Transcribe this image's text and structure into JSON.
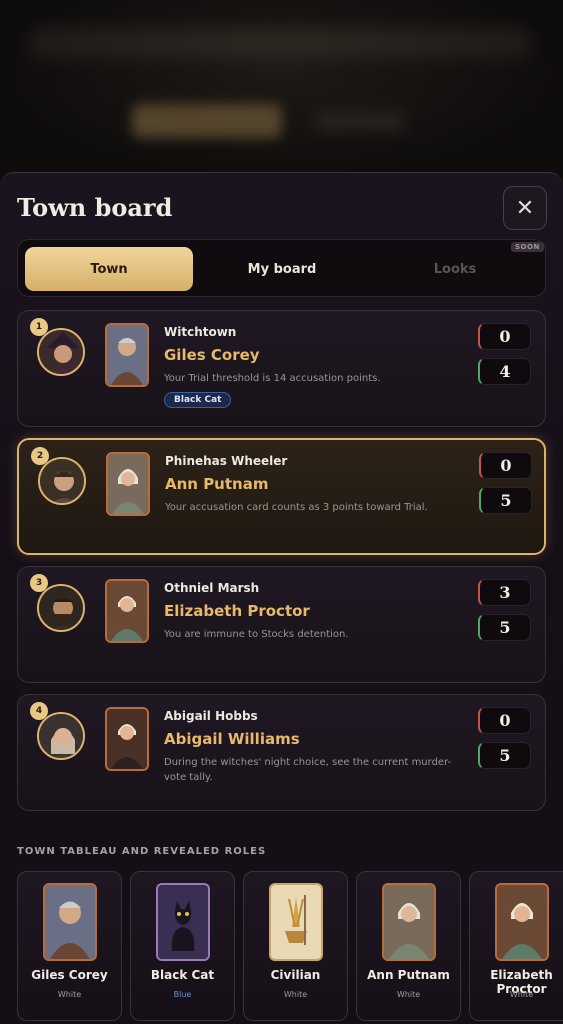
{
  "sheet": {
    "title": "Town board",
    "close_icon": "✕"
  },
  "tabs": [
    {
      "label": "Town",
      "active": true
    },
    {
      "label": "My board",
      "active": false
    },
    {
      "label": "Looks",
      "active": false,
      "badge": "SOON"
    }
  ],
  "players": [
    {
      "rank": "1",
      "player": "Witchtown",
      "role": "Giles Corey",
      "ability": "Your Trial threshold is 14 accusation points.",
      "tag": "Black Cat",
      "accusations": "0",
      "threshold": "4",
      "active": false
    },
    {
      "rank": "2",
      "player": "Phinehas Wheeler",
      "role": "Ann Putnam",
      "ability": "Your accusation card counts as 3 points toward Trial.",
      "accusations": "0",
      "threshold": "5",
      "active": true
    },
    {
      "rank": "3",
      "player": "Othniel Marsh",
      "role": "Elizabeth Proctor",
      "ability": "You are immune to Stocks detention.",
      "accusations": "3",
      "threshold": "5",
      "active": false
    },
    {
      "rank": "4",
      "player": "Abigail Hobbs",
      "role": "Abigail Williams",
      "ability": "During the witches' night choice, see the current murder-vote tally.",
      "accusations": "0",
      "threshold": "5",
      "active": false
    }
  ],
  "tableau": {
    "title": "TOWN TABLEAU AND REVEALED ROLES",
    "cards": [
      {
        "name": "Giles Corey",
        "team": "White"
      },
      {
        "name": "Black Cat",
        "team": "Blue"
      },
      {
        "name": "Civilian",
        "team": "White"
      },
      {
        "name": "Ann Putnam",
        "team": "White"
      },
      {
        "name": "Elizabeth Proctor",
        "team": "White"
      }
    ]
  },
  "colors": {
    "accent_gold": "#e8b969",
    "tab_active": "#f1d59a",
    "accusation_marker": "#c9534c",
    "threshold_marker": "#4fa866",
    "team_blue": "#6f8fd6"
  }
}
